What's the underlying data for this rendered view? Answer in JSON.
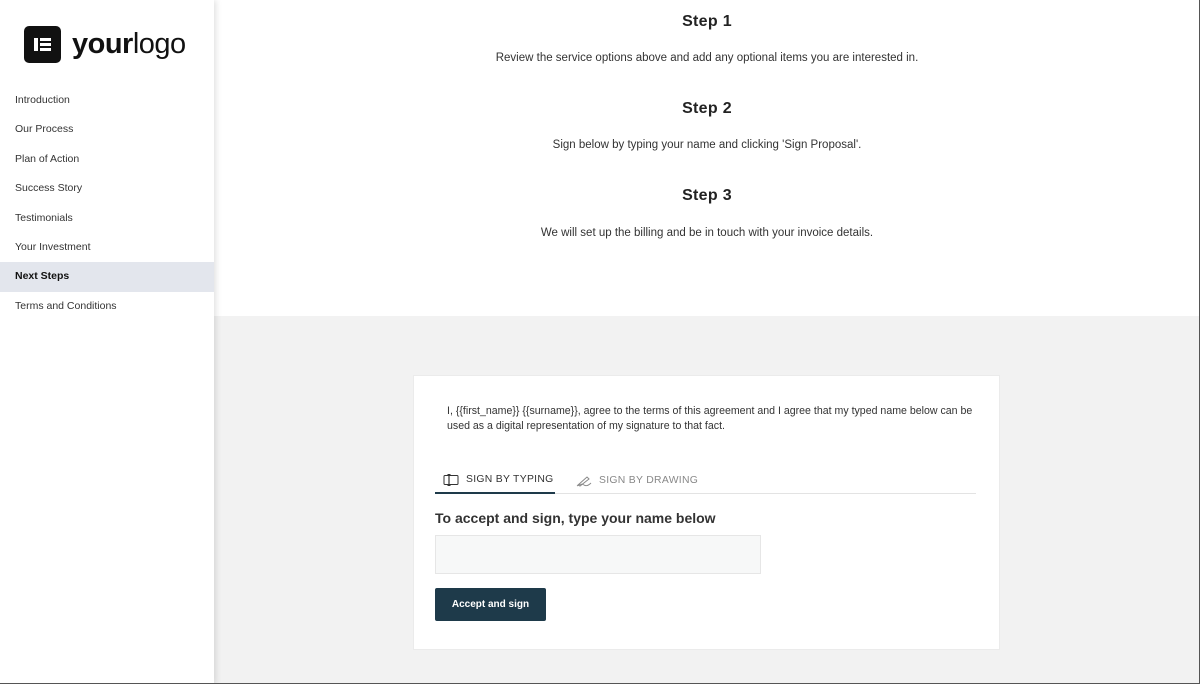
{
  "logo": {
    "bold": "your",
    "regular": "logo",
    "icon": "logo-mark-icon"
  },
  "sidebar": {
    "items": [
      {
        "label": "Introduction",
        "active": false
      },
      {
        "label": "Our Process",
        "active": false
      },
      {
        "label": "Plan of Action",
        "active": false
      },
      {
        "label": "Success Story",
        "active": false
      },
      {
        "label": "Testimonials",
        "active": false
      },
      {
        "label": "Your Investment",
        "active": false
      },
      {
        "label": "Next Steps",
        "active": true
      },
      {
        "label": "Terms and Conditions",
        "active": false
      }
    ]
  },
  "steps": [
    {
      "title": "Step 1",
      "desc": "Review the service options above and add any optional items you are interested in."
    },
    {
      "title": "Step 2",
      "desc": "Sign below by typing your name and clicking 'Sign Proposal'."
    },
    {
      "title": "Step 3",
      "desc": "We will set up the billing and be in touch with your invoice details."
    }
  ],
  "signature": {
    "agreement": "I, {{first_name}} {{surname}}, agree to the terms of this agreement and I agree that my typed name below can be used as a digital representation of my signature to that fact.",
    "tabs": [
      {
        "label": "SIGN BY TYPING",
        "icon": "keyboard-icon",
        "active": true
      },
      {
        "label": "SIGN BY DRAWING",
        "icon": "pen-icon",
        "active": false
      }
    ],
    "input_label": "To accept and sign, type your name below",
    "input_value": "",
    "input_placeholder": "",
    "button_label": "Accept and sign"
  },
  "colors": {
    "accent": "#1e3a4a",
    "nav_active_bg": "#e3e6ed",
    "section_bg": "#f2f2f2"
  }
}
